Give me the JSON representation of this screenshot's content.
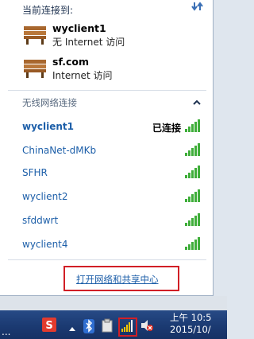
{
  "flyout": {
    "title": "当前连接到:",
    "connected": [
      {
        "name": "wyclient1",
        "sub": "无 Internet 访问"
      },
      {
        "name": "sf.com",
        "sub": "Internet 访问"
      }
    ],
    "section_label": "无线网络连接",
    "networks": [
      {
        "ssid": "wyclient1",
        "status": "已连接",
        "signal_bars": 5
      },
      {
        "ssid": "ChinaNet-dMKb",
        "status": "",
        "signal_bars": 5
      },
      {
        "ssid": "SFHR",
        "status": "",
        "signal_bars": 5
      },
      {
        "ssid": "wyclient2",
        "status": "",
        "signal_bars": 5
      },
      {
        "ssid": "sfddwrt",
        "status": "",
        "signal_bars": 5
      },
      {
        "ssid": "wyclient4",
        "status": "",
        "signal_bars": 5
      }
    ],
    "footer_link": "打开网络和共享中心"
  },
  "taskbar": {
    "left_dots": "...",
    "clock_time": "上午 10:5",
    "clock_date": "2015/10/"
  },
  "colors": {
    "link_blue": "#1d5fa9",
    "signal_green": "#3fae3a",
    "highlight_red": "#d11f26",
    "taskbar_blue": "#1b3a72"
  },
  "icons": {
    "refresh": "refresh-icon",
    "connection": "bench-network-icon",
    "collapse": "chevron-up-icon",
    "signal": "signal-bars-icon"
  }
}
